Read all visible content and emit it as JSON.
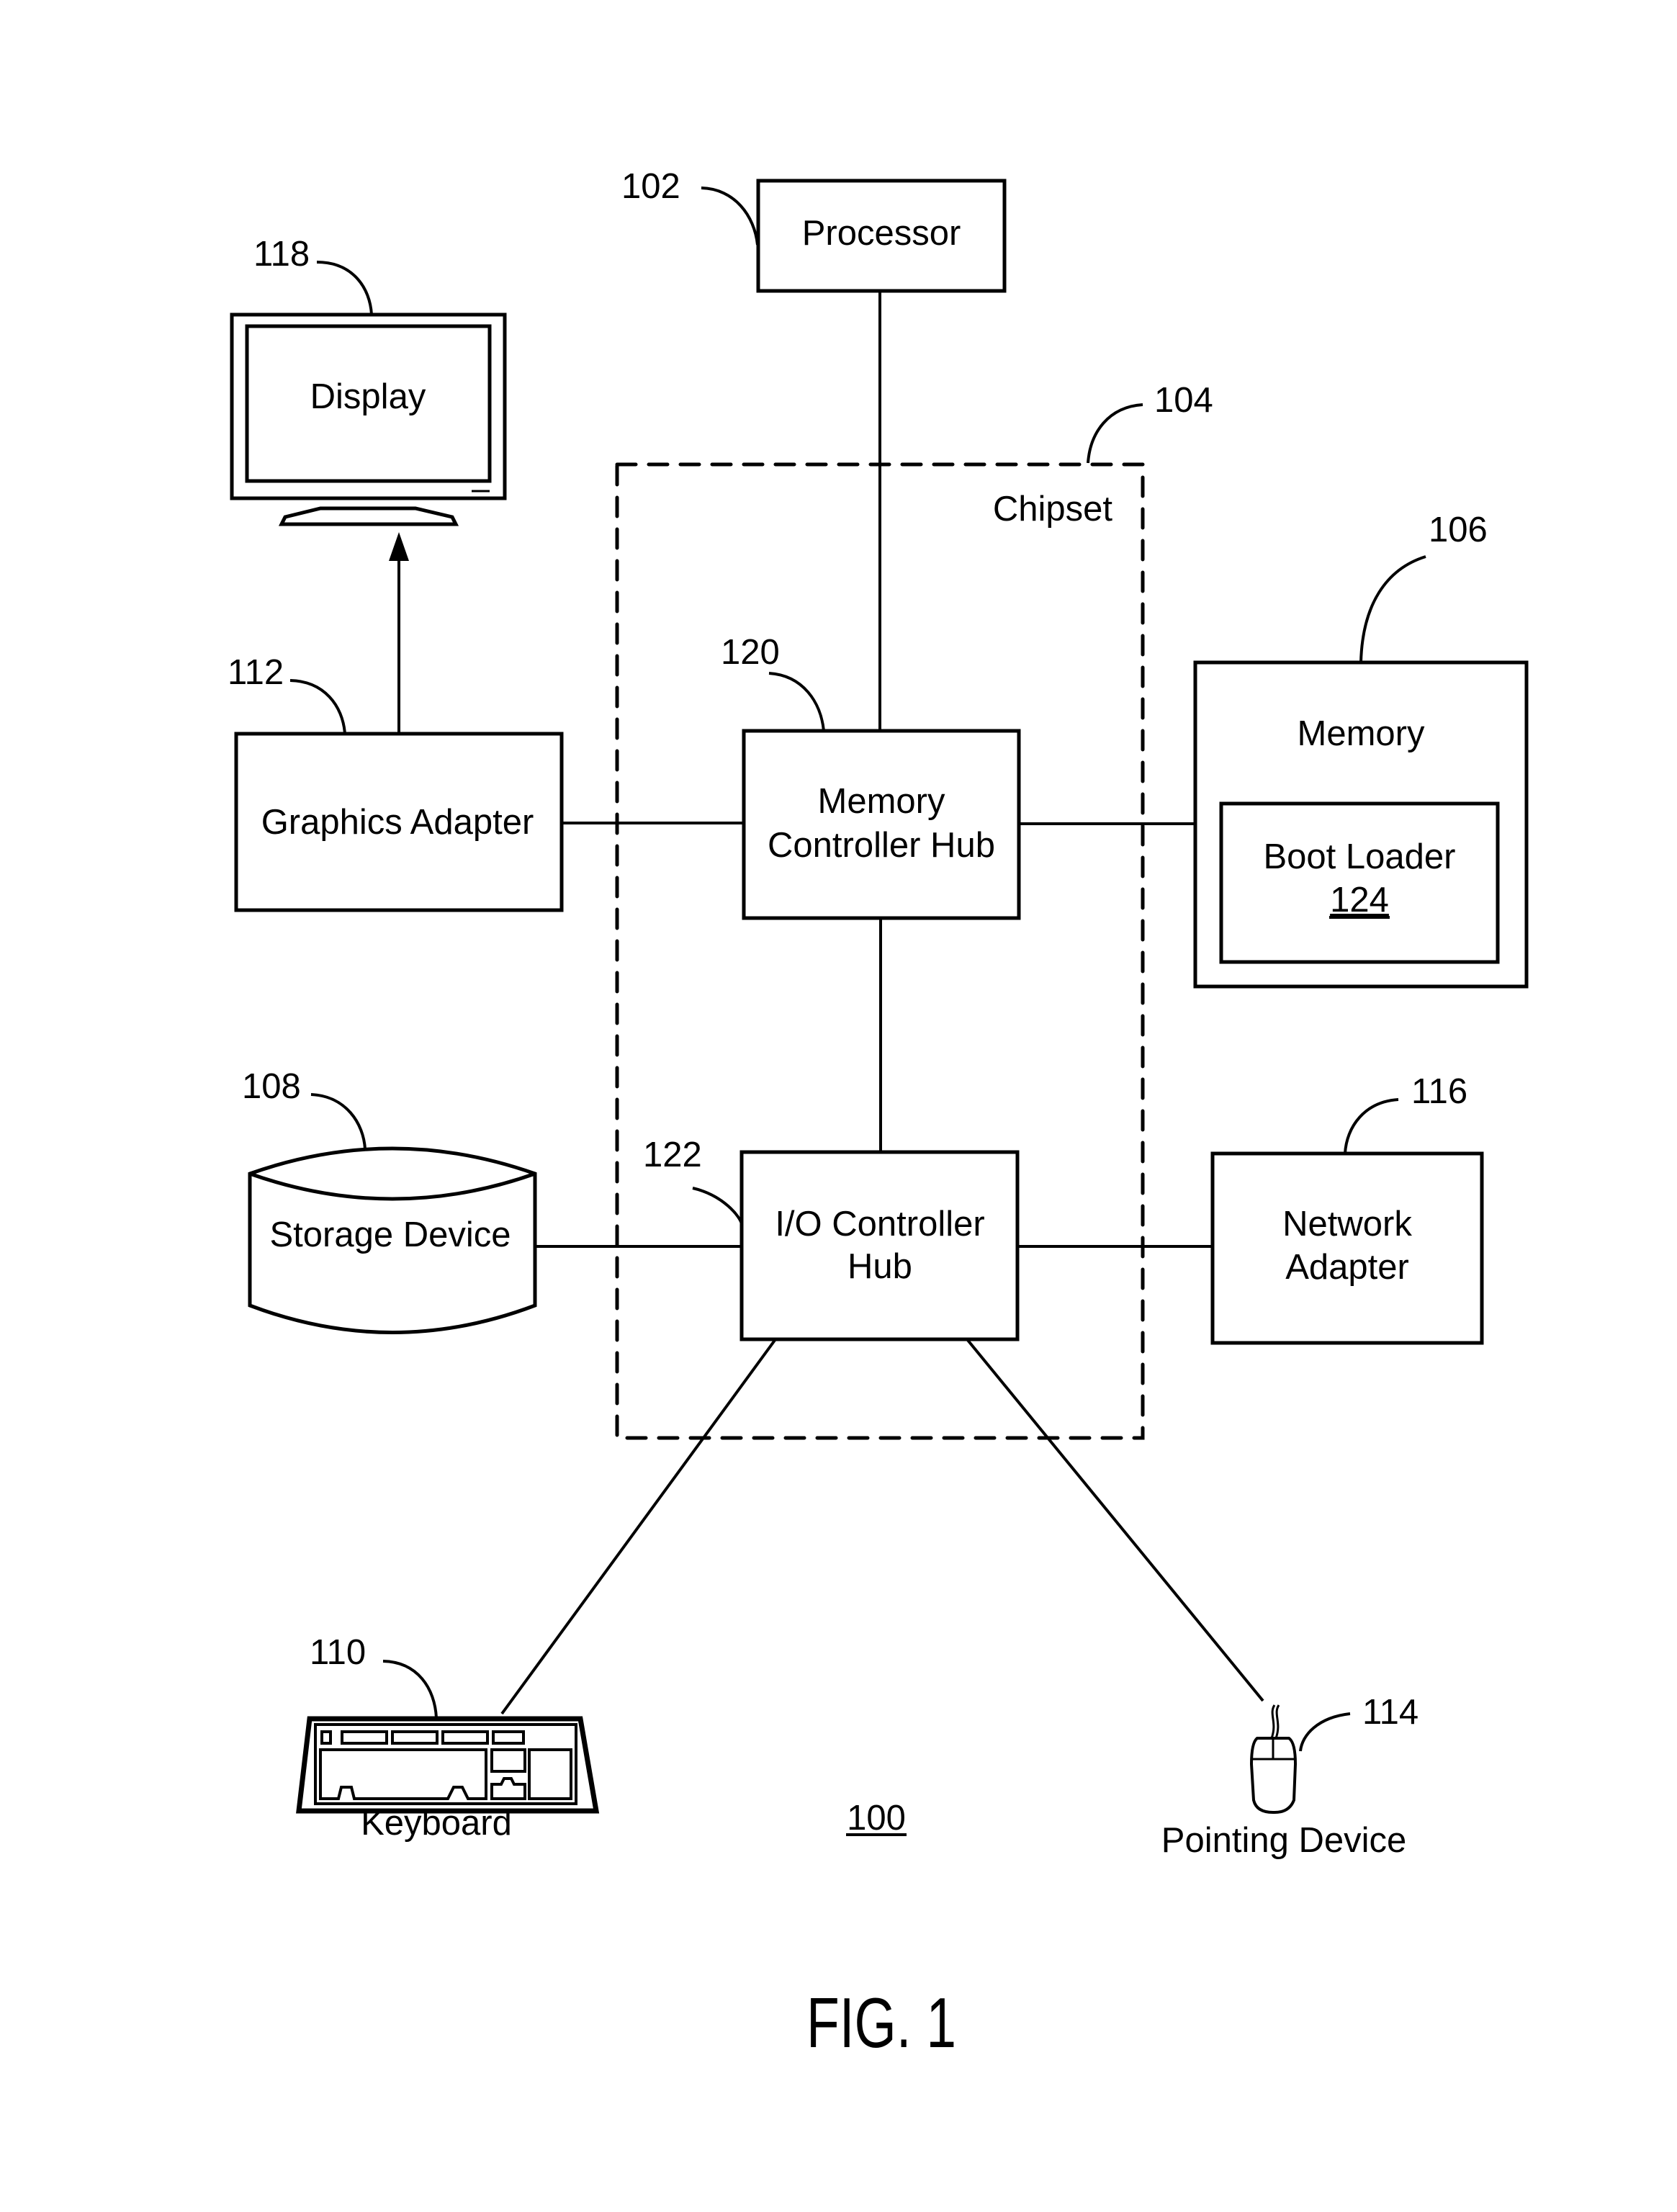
{
  "figure": {
    "caption": "FIG. 1",
    "system_ref": "100",
    "colors": {
      "ink": "#000000",
      "paper": "#ffffff"
    }
  },
  "components": {
    "processor": {
      "label": "Processor",
      "ref": "102"
    },
    "chipset": {
      "label": "Chipset",
      "ref": "104"
    },
    "memory": {
      "label": "Memory",
      "ref": "106"
    },
    "boot_loader": {
      "label": "Boot Loader",
      "ref": "124"
    },
    "storage": {
      "label": "Storage Device",
      "ref": "108"
    },
    "keyboard": {
      "label": "Keyboard",
      "ref": "110",
      "icon": "keyboard-icon"
    },
    "graphics_adapter": {
      "label": "Graphics Adapter",
      "ref": "112"
    },
    "pointing_device": {
      "label": "Pointing Device",
      "ref": "114",
      "icon": "mouse-icon"
    },
    "network_adapter": {
      "label_line1": "Network",
      "label_line2": "Adapter",
      "ref": "116"
    },
    "display": {
      "label": "Display",
      "ref": "118",
      "icon": "monitor-icon"
    },
    "mch": {
      "label_line1": "Memory",
      "label_line2": "Controller Hub",
      "ref": "120"
    },
    "ioch": {
      "label_line1": "I/O Controller",
      "label_line2": "Hub",
      "ref": "122"
    }
  },
  "connections": [
    {
      "from": "processor",
      "to": "mch"
    },
    {
      "from": "graphics_adapter",
      "to": "mch"
    },
    {
      "from": "mch",
      "to": "memory"
    },
    {
      "from": "mch",
      "to": "ioch"
    },
    {
      "from": "storage",
      "to": "ioch"
    },
    {
      "from": "ioch",
      "to": "network_adapter"
    },
    {
      "from": "ioch",
      "to": "keyboard"
    },
    {
      "from": "ioch",
      "to": "pointing_device"
    },
    {
      "from": "graphics_adapter",
      "to": "display",
      "arrow": true
    }
  ]
}
